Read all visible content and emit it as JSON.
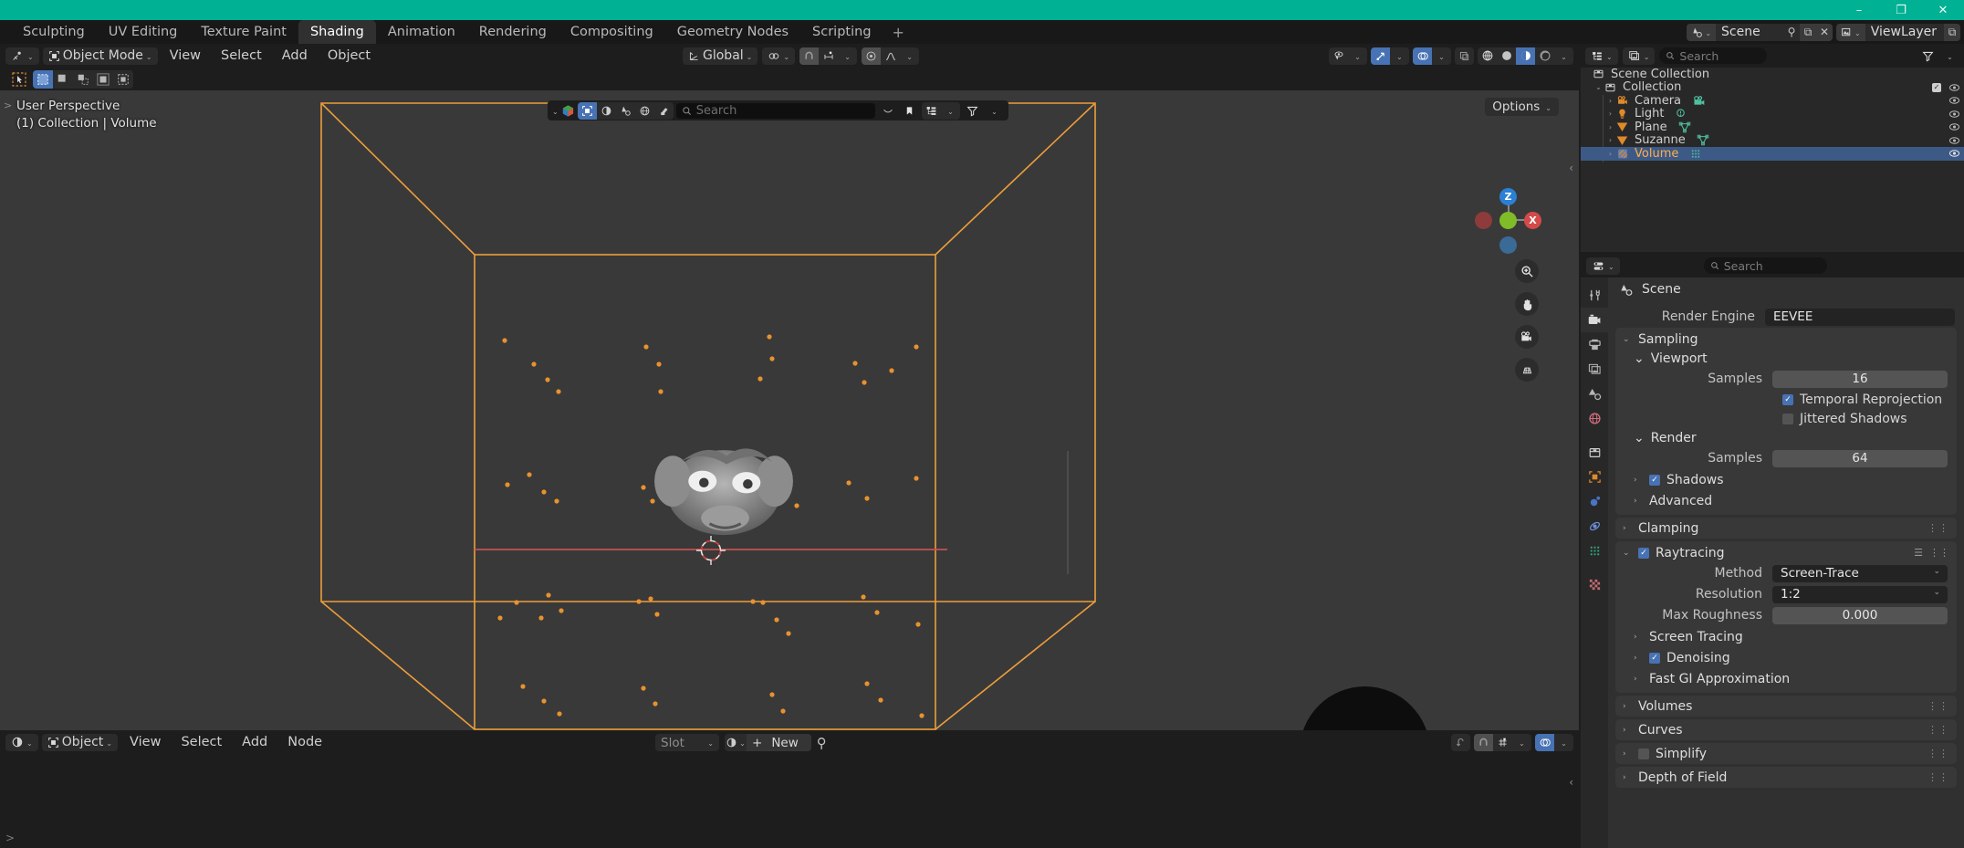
{
  "window": {
    "minimize": "–",
    "maximize": "❐",
    "close": "✕"
  },
  "topbar": {
    "tabs": [
      {
        "label": "Sculpting",
        "active": false
      },
      {
        "label": "UV Editing",
        "active": false
      },
      {
        "label": "Texture Paint",
        "active": false
      },
      {
        "label": "Shading",
        "active": true
      },
      {
        "label": "Animation",
        "active": false
      },
      {
        "label": "Rendering",
        "active": false
      },
      {
        "label": "Compositing",
        "active": false
      },
      {
        "label": "Geometry Nodes",
        "active": false
      },
      {
        "label": "Scripting",
        "active": false
      }
    ],
    "add_tab": "+",
    "scene_label": "Scene",
    "viewlayer_label": "ViewLayer",
    "scene_icon": "scene-icon",
    "viewlayer_icon": "viewlayer-icon",
    "pin_icon": "pin-icon",
    "copy_icon": "new-copy-icon",
    "unlink_icon": "unlink-x-icon"
  },
  "viewport": {
    "mode": "Object Mode",
    "menus": [
      "View",
      "Select",
      "Add",
      "Object"
    ],
    "transform_orientation": "Global",
    "snap_icon": "magnet-icon",
    "proportional_icon": "proportional-edit-icon",
    "options_label": "Options",
    "overlay_text_line1": "User Perspective",
    "overlay_text_line2": "(1) Collection | Volume",
    "search_placeholder": "Search",
    "gizmo_axes": [
      {
        "label": "Z",
        "color": "#2b7fd4"
      },
      {
        "label": "X",
        "color": "#d44a4a"
      },
      {
        "label": "Y",
        "color": "#7fbc27"
      }
    ],
    "nav_buttons": [
      "zoom-icon",
      "pan-hand-icon",
      "camera-view-icon",
      "ortho-persp-icon"
    ],
    "shading_modes": [
      "wireframe-icon",
      "solid-icon",
      "material-preview-icon",
      "rendered-icon"
    ],
    "active_shading_mode": "material-preview-icon"
  },
  "shader_editor": {
    "editor_type_icon": "shading-icon",
    "shader_type": "Object",
    "menus": [
      "View",
      "Select",
      "Add",
      "Node"
    ],
    "slot_label": "Slot",
    "new_label": "New",
    "pin_icon": "pin-icon"
  },
  "outliner": {
    "display_mode_icon": "outliner-display-icon",
    "filter_icon": "filter-funnel-icon",
    "search_placeholder": "Search",
    "items": [
      {
        "label": "Scene Collection",
        "icon": "collection-icon",
        "indent": 0,
        "expandable": false,
        "selected": false,
        "checkbox": false,
        "eye": false
      },
      {
        "label": "Collection",
        "icon": "collection-icon",
        "indent": 1,
        "expandable": true,
        "expanded": true,
        "selected": false,
        "checkbox": true,
        "eye": true
      },
      {
        "label": "Camera",
        "icon": "camera-icon",
        "data_icon": "camera-data-icon",
        "indent": 2,
        "expandable": true,
        "expanded": false,
        "selected": false,
        "checkbox": false,
        "eye": true
      },
      {
        "label": "Light",
        "icon": "light-icon",
        "data_icon": "light-data-icon",
        "indent": 2,
        "expandable": true,
        "expanded": false,
        "selected": false,
        "checkbox": false,
        "eye": true
      },
      {
        "label": "Plane",
        "icon": "mesh-icon",
        "data_icon": "mesh-data-icon",
        "indent": 2,
        "expandable": true,
        "expanded": false,
        "selected": false,
        "checkbox": false,
        "eye": true
      },
      {
        "label": "Suzanne",
        "icon": "mesh-icon",
        "data_icon": "mesh-data-icon",
        "indent": 2,
        "expandable": true,
        "expanded": false,
        "selected": false,
        "checkbox": false,
        "eye": true
      },
      {
        "label": "Volume",
        "icon": "volume-icon",
        "data_icon": "volume-data-icon",
        "indent": 2,
        "expandable": true,
        "expanded": false,
        "selected": true,
        "checkbox": false,
        "eye": true
      }
    ]
  },
  "properties": {
    "search_placeholder": "Search",
    "editor_selector_icon": "properties-editor-icon",
    "context_title": "Scene",
    "context_icon": "render-properties-icon",
    "tabs": [
      {
        "name": "tool-tab",
        "icon": "tool-icon",
        "active": false
      },
      {
        "name": "render-tab",
        "icon": "render-camera-icon",
        "active": true
      },
      {
        "name": "output-tab",
        "icon": "printer-icon",
        "active": false
      },
      {
        "name": "viewlayer-tab",
        "icon": "images-icon",
        "active": false
      },
      {
        "name": "scene-tab",
        "icon": "scene-cone-icon",
        "active": false
      },
      {
        "name": "world-tab",
        "icon": "world-globe-icon",
        "active": false
      },
      {
        "name": "collection-tab",
        "icon": "collection-box-icon",
        "active": false
      },
      {
        "name": "object-tab",
        "icon": "object-square-icon",
        "active": false
      },
      {
        "name": "modifiers-tab",
        "icon": "wrench-physics-icon",
        "active": false
      },
      {
        "name": "physics-tab",
        "icon": "physics-orbit-icon",
        "active": false
      },
      {
        "name": "object-data-tab",
        "icon": "volume-data-green-icon",
        "active": false
      },
      {
        "name": "material-tab",
        "icon": "material-checker-icon",
        "active": false
      }
    ],
    "render_engine": {
      "label": "Render Engine",
      "value": "EEVEE"
    },
    "sampling": {
      "title": "Sampling",
      "viewport": {
        "title": "Viewport",
        "samples_label": "Samples",
        "samples_value": "16",
        "temporal_reprojection": {
          "label": "Temporal Reprojection",
          "checked": true
        },
        "jittered_shadows": {
          "label": "Jittered Shadows",
          "checked": false
        }
      },
      "render": {
        "title": "Render",
        "samples_label": "Samples",
        "samples_value": "64",
        "shadows": {
          "label": "Shadows",
          "checked": true
        },
        "advanced": {
          "label": "Advanced"
        }
      }
    },
    "clamping": {
      "title": "Clamping"
    },
    "raytracing": {
      "title": "Raytracing",
      "checked": true,
      "method_label": "Method",
      "method_value": "Screen-Trace",
      "resolution_label": "Resolution",
      "resolution_value": "1:2",
      "max_roughness_label": "Max Roughness",
      "max_roughness_value": "0.000",
      "screen_tracing": {
        "label": "Screen Tracing"
      },
      "denoising": {
        "label": "Denoising",
        "checked": true
      },
      "fast_gi": {
        "label": "Fast GI Approximation"
      }
    },
    "volumes": {
      "title": "Volumes"
    },
    "curves": {
      "title": "Curves"
    },
    "simplify": {
      "title": "Simplify",
      "checked": false
    },
    "depth_of_field": {
      "title": "Depth of Field"
    }
  }
}
